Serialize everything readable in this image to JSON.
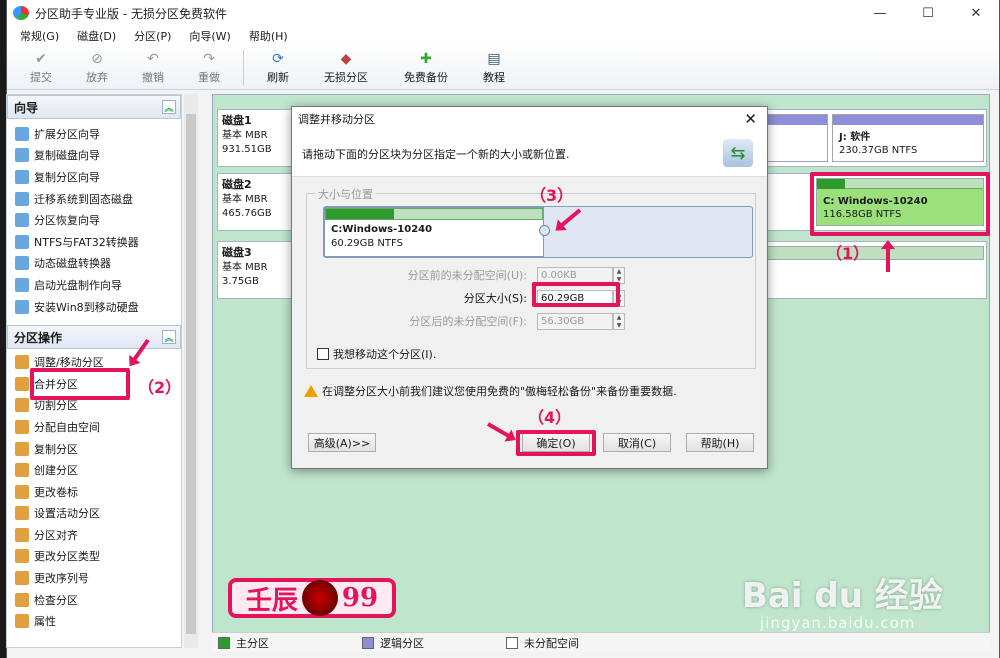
{
  "window": {
    "title": "分区助手专业版 - 无损分区免费软件",
    "min": "—",
    "max": "☐",
    "close": "✕"
  },
  "menu": [
    "常规(G)",
    "磁盘(D)",
    "分区(P)",
    "向导(W)",
    "帮助(H)"
  ],
  "toolbar": {
    "commit": "提交",
    "discard": "放弃",
    "undo": "撤销",
    "redo": "重做",
    "refresh": "刷新",
    "lossless": "无损分区",
    "backup": "免费备份",
    "tutorial": "教程"
  },
  "sidebar": {
    "wizard_title": "向导",
    "wizard_items": [
      "扩展分区向导",
      "复制磁盘向导",
      "复制分区向导",
      "迁移系统到固态磁盘",
      "分区恢复向导",
      "NTFS与FAT32转换器",
      "动态磁盘转换器",
      "启动光盘制作向导",
      "安装Win8到移动硬盘"
    ],
    "ops_title": "分区操作",
    "ops_items": [
      "调整/移动分区",
      "合并分区",
      "切割分区",
      "分配自由空间",
      "复制分区",
      "创建分区",
      "更改卷标",
      "设置活动分区",
      "分区对齐",
      "更改分区类型",
      "更改序列号",
      "检查分区",
      "属性"
    ]
  },
  "disks": [
    {
      "name": "磁盘1",
      "type": "基本 MBR",
      "size": "931.51GB"
    },
    {
      "name": "磁盘2",
      "type": "基本 MBR",
      "size": "465.76GB"
    },
    {
      "name": "磁盘3",
      "type": "基本 MBR",
      "size": "3.75GB"
    }
  ],
  "partitions": {
    "j": {
      "name": "J: 软件",
      "info": "230.37GB NTFS"
    },
    "c": {
      "name": "C: Windows-10240",
      "info": "116.58GB NTFS"
    }
  },
  "legend": {
    "primary": "主分区",
    "logical": "逻辑分区",
    "unallocated": "未分配空间"
  },
  "dialog": {
    "title": "调整并移动分区",
    "close": "✕",
    "header": "请拖动下面的分区块为分区指定一个新的大小或新位置.",
    "group": "大小与位置",
    "part_name": "C:Windows-10240",
    "part_info": "60.29GB NTFS",
    "before_label": "分区前的未分配空间(U):",
    "before_value": "0.00KB",
    "size_label": "分区大小(S):",
    "size_value": "60.29GB",
    "after_label": "分区后的未分配空间(F):",
    "after_value": "56.30GB",
    "move_checkbox": "我想移动这个分区(I).",
    "warning": "在调整分区大小前我们建议您使用免费的\"傲梅轻松备份\"来备份重要数据.",
    "advanced": "高级(A)>>",
    "ok": "确定(O)",
    "cancel": "取消(C)",
    "help": "帮助(H)"
  },
  "annotations": {
    "a1": "（1）",
    "a2": "（2）",
    "a3": "（3）",
    "a4": "（4）"
  },
  "badge": {
    "left": "壬辰",
    "right": "99"
  },
  "watermark": {
    "main": "Bai du 经验",
    "sub": "jingyan.baidu.com"
  },
  "colors": {
    "accent": "#e4145c",
    "primary_part": "#2e9a2e",
    "logical_part": "#8e8ed8"
  }
}
